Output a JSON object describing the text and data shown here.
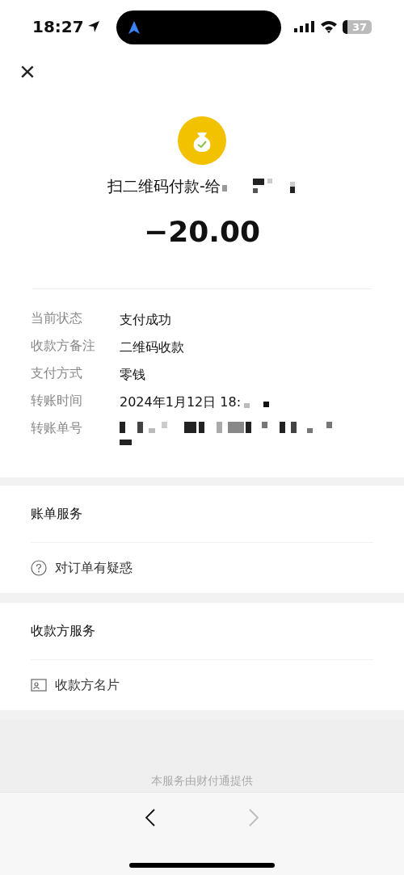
{
  "status_bar": {
    "time": "18:27",
    "battery": "37"
  },
  "header": {
    "close": "×"
  },
  "payment": {
    "title": "扫二维码付款-给",
    "amount": "−20.00"
  },
  "details": [
    {
      "label": "当前状态",
      "value": "支付成功",
      "kind": "text"
    },
    {
      "label": "收款方备注",
      "value": "二维码收款",
      "kind": "text"
    },
    {
      "label": "支付方式",
      "value": "零钱",
      "kind": "text"
    },
    {
      "label": "转账时间",
      "value": "2024年1月12日 18:",
      "kind": "partly-hidden"
    },
    {
      "label": "转账单号",
      "kind": "hidden"
    }
  ],
  "sections": [
    {
      "title": "账单服务",
      "item": {
        "label": "对订单有疑惑",
        "kind": "question"
      }
    },
    {
      "title": "收款方服务",
      "item": {
        "label": "收款方名片",
        "kind": "card"
      }
    }
  ],
  "footer": {
    "provider": "本服务由财付通提供"
  },
  "nav": {
    "back": {
      "disabled": false
    },
    "forward": {
      "disabled": true
    }
  }
}
